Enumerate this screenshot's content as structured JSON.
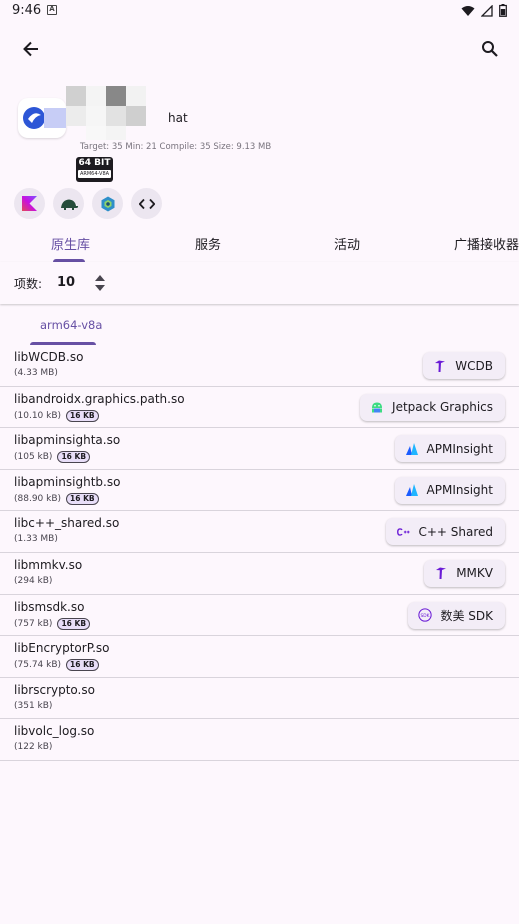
{
  "status_bar": {
    "time": "9:46",
    "notification_letter": "A"
  },
  "app": {
    "name_suffix": "hat",
    "meta": "Target: 35 Min: 21 Compile: 35 Size: 9.13 MB",
    "bit_label": "64 BIT",
    "abi_label": "ARM64-V8A"
  },
  "tabs": [
    "原生库",
    "服务",
    "活动",
    "广播接收器"
  ],
  "count": {
    "label": "项数:",
    "value": "10"
  },
  "abi_tab": "arm64-v8a",
  "libraries": [
    {
      "name": "libWCDB.so",
      "size": "(4.33 MB)",
      "badge": "",
      "chip": "WCDB",
      "chip_icon": "tencent-mars-icon"
    },
    {
      "name": "libandroidx.graphics.path.so",
      "size": "(10.10 kB)",
      "badge": "16 KB",
      "chip": "Jetpack Graphics",
      "chip_icon": "android-icon"
    },
    {
      "name": "libapminsighta.so",
      "size": "(105 kB)",
      "badge": "16 KB",
      "chip": "APMInsight",
      "chip_icon": "apminsight-icon"
    },
    {
      "name": "libapminsightb.so",
      "size": "(88.90 kB)",
      "badge": "16 KB",
      "chip": "APMInsight",
      "chip_icon": "apminsight-icon"
    },
    {
      "name": "libc++_shared.so",
      "size": "(1.33 MB)",
      "badge": "",
      "chip": "C++ Shared",
      "chip_icon": "cpp-icon"
    },
    {
      "name": "libmmkv.so",
      "size": "(294 kB)",
      "badge": "",
      "chip": "MMKV",
      "chip_icon": "tencent-mars-icon"
    },
    {
      "name": "libsmsdk.so",
      "size": "(757 kB)",
      "badge": "16 KB",
      "chip": "数美 SDK",
      "chip_icon": "sdk-icon"
    },
    {
      "name": "libEncryptorP.so",
      "size": "(75.74 kB)",
      "badge": "16 KB",
      "chip": "",
      "chip_icon": ""
    },
    {
      "name": "librscrypto.so",
      "size": "(351 kB)",
      "badge": "",
      "chip": "",
      "chip_icon": ""
    },
    {
      "name": "libvolc_log.so",
      "size": "(122 kB)",
      "badge": "",
      "chip": "",
      "chip_icon": ""
    }
  ],
  "colors": {
    "accent": "#6750a4",
    "background": "#fdf7fd",
    "chip_bg": "#f3edf7"
  }
}
